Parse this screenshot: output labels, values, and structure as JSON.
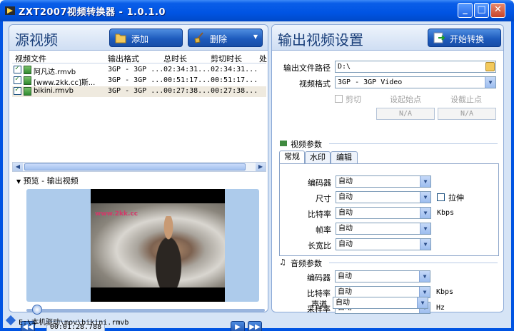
{
  "window": {
    "title": "ZXT2007视频转换器 - 1.0.1.0",
    "minimize": "_",
    "maximize": "□",
    "close": "✕"
  },
  "left": {
    "title": "源视频",
    "add_label": "添加",
    "delete_label": "删除",
    "columns": [
      "视频文件",
      "输出格式",
      "总时长",
      "剪切时长",
      "处"
    ],
    "rows": [
      {
        "file": "阿凡达.rmvb",
        "format": "3GP - 3GP ...",
        "total": "02:34:31...",
        "cut": "02:34:31..."
      },
      {
        "file": "[www.2kk.cc]斯...",
        "format": "3GP - 3GP ...",
        "total": "00:51:17...",
        "cut": "00:51:17..."
      },
      {
        "file": "bikini.rmvb",
        "format": "3GP - 3GP ...",
        "total": "00:27:38...",
        "cut": "00:27:38..."
      }
    ],
    "preview_label": "预览 - 输出视频",
    "watermark": "www.2kk.cc",
    "time": "00:01:28.788"
  },
  "right": {
    "title": "输出视频设置",
    "start_label": "开始转换",
    "out_path_label": "输出文件路径",
    "out_path": "D:\\",
    "format_label": "视频格式",
    "format": "3GP - 3GP Video",
    "cut_label": "剪切",
    "start_point_label": "设起始点",
    "end_point_label": "设截止点",
    "start_point": "N/A",
    "end_point": "N/A",
    "video_section": "视频参数",
    "tabs": [
      "常规",
      "水印",
      "编辑"
    ],
    "encoder_label": "编码器",
    "size_label": "尺寸",
    "bitrate_label": "比特率",
    "fps_label": "帧率",
    "aspect_label": "长宽比",
    "stretch_label": "拉伸",
    "kbps": "Kbps",
    "auto": "自动",
    "audio_section": "音频参数",
    "a_encoder_label": "编码器",
    "a_bitrate_label": "比特率",
    "a_samplerate_label": "采样率",
    "a_channel_label": "声道",
    "hz": "Hz"
  },
  "status": {
    "path": "E:\\本机驱动\\mov\\bikini.rmvb"
  }
}
